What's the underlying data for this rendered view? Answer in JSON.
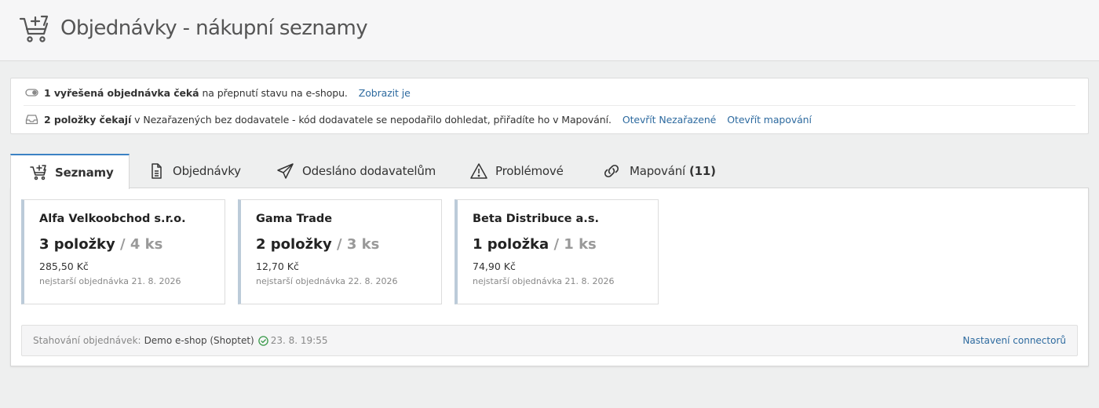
{
  "header": {
    "title": "Objednávky - nákupní seznamy",
    "icon": "cart-plus-icon"
  },
  "notices": [
    {
      "icon": "toggle-icon",
      "bold": "1 vyřešená objednávka čeká",
      "text": "na přepnutí stavu na e-shopu.",
      "links": [
        "Zobrazit je"
      ]
    },
    {
      "icon": "inbox-icon",
      "bold": "2 položky čekají",
      "text": "v Nezařazených bez dodavatele - kód dodavatele se nepodařilo dohledat, přiřadíte ho v Mapování.",
      "links": [
        "Otevřít Nezařazené",
        "Otevřít mapování"
      ]
    }
  ],
  "tabs": [
    {
      "label": "Seznamy",
      "icon": "cart-plus-icon",
      "active": true
    },
    {
      "label": "Objednávky",
      "icon": "document-icon",
      "active": false
    },
    {
      "label": "Odesláno dodavatelům",
      "icon": "paper-plane-icon",
      "active": false
    },
    {
      "label": "Problémové",
      "icon": "warning-icon",
      "active": false
    },
    {
      "label": "Mapování",
      "badge": "(11)",
      "icon": "link-icon",
      "active": false
    }
  ],
  "cards": [
    {
      "supplier": "Alfa Velkoobchod s.r.o.",
      "items": "3 položky",
      "qty": "/ 4 ks",
      "price": "285,50 Kč",
      "oldest": "nejstarší objednávka 21. 8. 2026"
    },
    {
      "supplier": "Gama Trade",
      "items": "2 položky",
      "qty": "/ 3 ks",
      "price": "12,70 Kč",
      "oldest": "nejstarší objednávka 22. 8. 2026"
    },
    {
      "supplier": "Beta Distribuce a.s.",
      "items": "1 položka",
      "qty": "/ 1 ks",
      "price": "74,90 Kč",
      "oldest": "nejstarší objednávka 21. 8. 2026"
    }
  ],
  "footer": {
    "label": "Stahování objednávek:",
    "shop": "Demo e-shop (Shoptet)",
    "status_icon": "check-circle-icon",
    "time": "23. 8. 19:55",
    "link": "Nastavení connectorů"
  },
  "colors": {
    "link": "#2d6a9f",
    "active_tab": "#3b82c4",
    "card_accent": "#bccbd9",
    "ok": "#3a9a4a"
  }
}
